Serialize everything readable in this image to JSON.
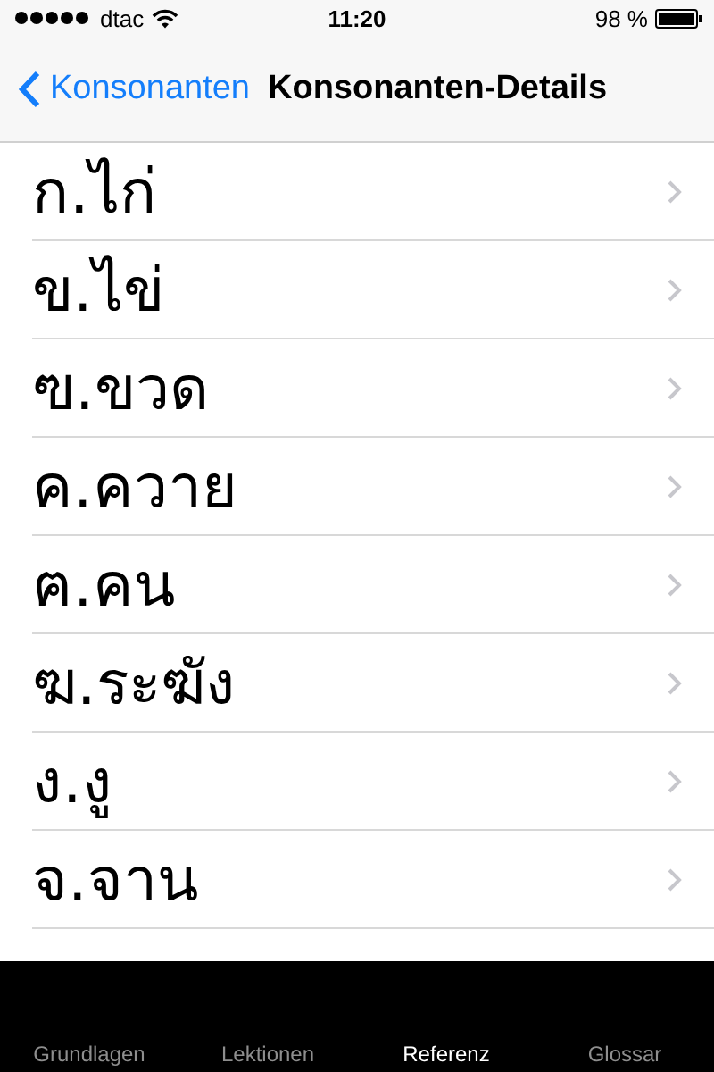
{
  "status_bar": {
    "carrier": "dtac",
    "time": "11:20",
    "battery": "98 %"
  },
  "nav_bar": {
    "back": "Konsonanten",
    "title": "Konsonanten-Details"
  },
  "list": [
    {
      "label": "ก.ไก่"
    },
    {
      "label": "ข.ไข่"
    },
    {
      "label": "ฃ.ขวด"
    },
    {
      "label": "ค.ควาย"
    },
    {
      "label": "ฅ.คน"
    },
    {
      "label": "ฆ.ระฆัง"
    },
    {
      "label": "ง.งู"
    },
    {
      "label": "จ.จาน"
    }
  ],
  "tab_bar": [
    {
      "label": "Grundlagen",
      "selected": false
    },
    {
      "label": "Lektionen",
      "selected": false
    },
    {
      "label": "Referenz",
      "selected": true
    },
    {
      "label": "Glossar",
      "selected": false
    }
  ]
}
